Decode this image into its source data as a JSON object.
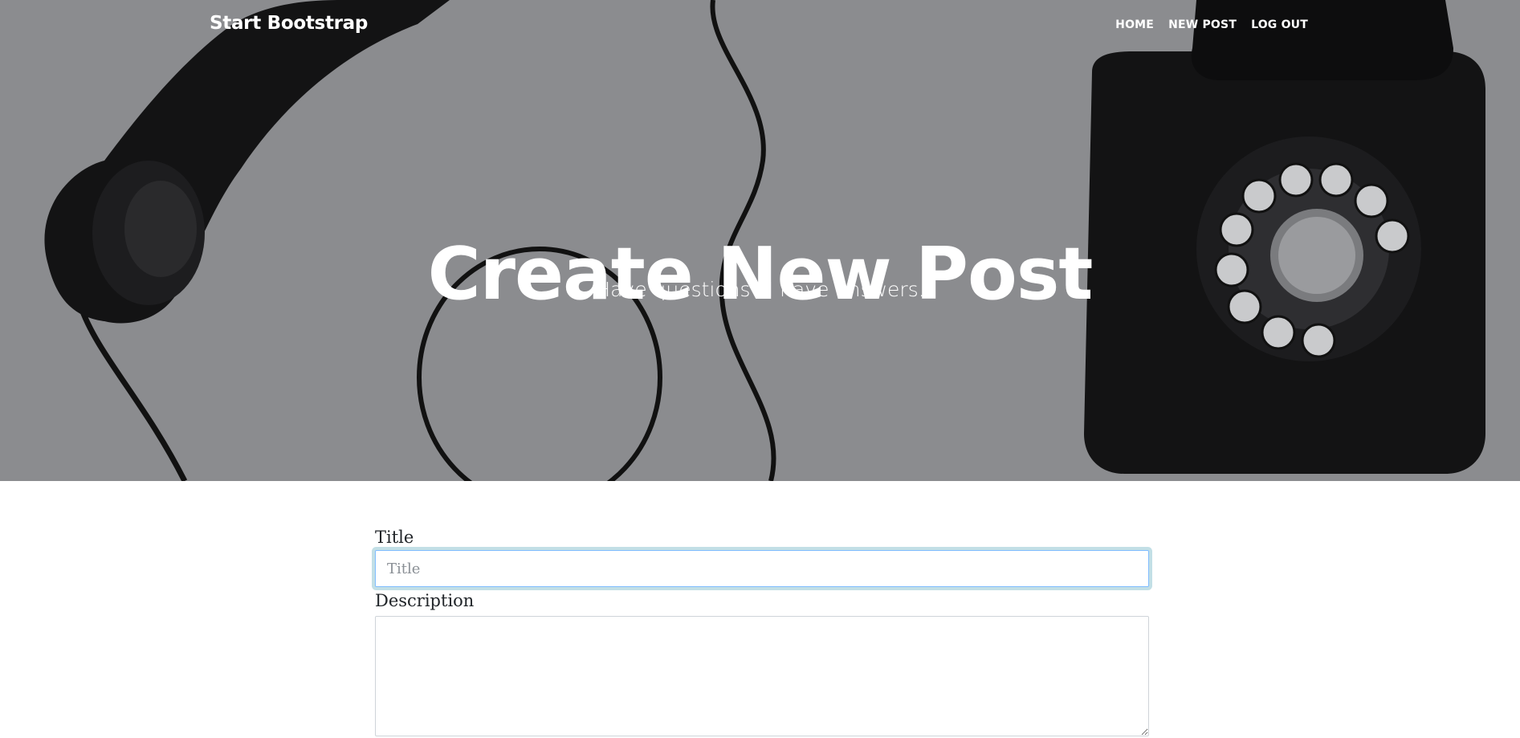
{
  "navbar": {
    "brand": "Start Bootstrap",
    "links": [
      {
        "label": "HOME"
      },
      {
        "label": "NEW POST"
      },
      {
        "label": "LOG OUT"
      }
    ]
  },
  "masthead": {
    "heading": "Create New Post",
    "subheading": "Have questions? I have answers.",
    "background_icon": "vintage-rotary-telephone",
    "overlay_color": "#8a8b8e"
  },
  "form": {
    "title_label": "Title",
    "title_placeholder": "Title",
    "title_value": "",
    "description_label": "Description",
    "description_value": ""
  },
  "colors": {
    "focus_ring": "#a8d4dc",
    "text": "#212529",
    "header_text": "#ffffff"
  }
}
